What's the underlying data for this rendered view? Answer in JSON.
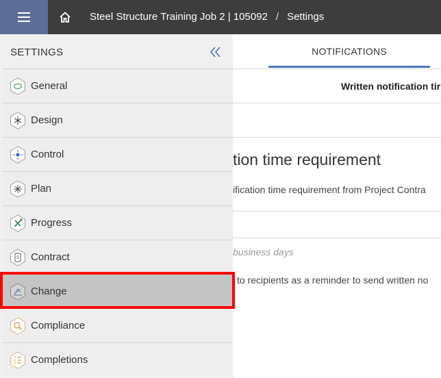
{
  "header": {
    "project": "Steel Structure Training Job 2 | 105092",
    "separator": "/",
    "page": "Settings",
    "menu_icon": "hamburger-icon",
    "home_icon": "home-icon"
  },
  "sidebar": {
    "title": "SETTINGS",
    "collapse_icon": "double-chevron-left-icon",
    "items": [
      {
        "label": "General",
        "icon": "general-icon",
        "color": "#6aaa74"
      },
      {
        "label": "Design",
        "icon": "design-icon",
        "color": "#555555"
      },
      {
        "label": "Control",
        "icon": "control-icon",
        "color": "#2f6fc4"
      },
      {
        "label": "Plan",
        "icon": "plan-icon",
        "color": "#555555"
      },
      {
        "label": "Progress",
        "icon": "progress-icon",
        "color": "#2f8a57"
      },
      {
        "label": "Contract",
        "icon": "contract-icon",
        "color": "#777777"
      },
      {
        "label": "Change",
        "icon": "change-icon",
        "color": "#7a85a8",
        "active": true
      },
      {
        "label": "Compliance",
        "icon": "compliance-icon",
        "color": "#e89a3c"
      },
      {
        "label": "Completions",
        "icon": "completions-icon",
        "color": "#e89a3c"
      }
    ]
  },
  "main": {
    "tab": "NOTIFICATIONS",
    "column_header": "Written notification tir",
    "section_title": "tion time requirement",
    "section_desc": "ification time requirement from Project Contra",
    "days_placeholder": "business days",
    "note": "to recipients as a reminder to send written no"
  },
  "colors": {
    "topbar": "#3d3d3d",
    "menu_button": "#5c6d96",
    "accent": "#4a78b8",
    "highlight": "#ff0000"
  }
}
